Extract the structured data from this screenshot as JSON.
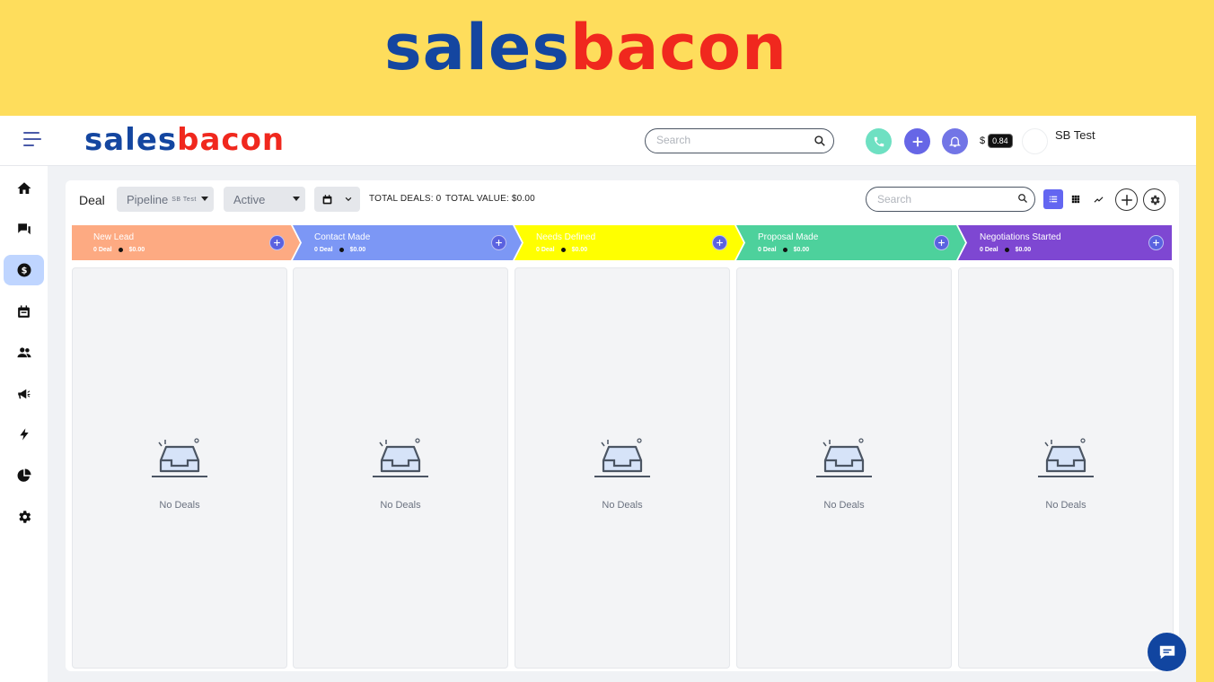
{
  "brand": {
    "part1": "sales",
    "part2": "bacon",
    "blue": "#1446a0",
    "red": "#f0281e"
  },
  "topbar": {
    "search_placeholder": "Search",
    "credit_currency": "$",
    "credit_value": "0.84",
    "user_name": "SB Test",
    "icons": [
      "menu-icon",
      "search-icon",
      "phone-icon",
      "plus-icon",
      "bell-icon"
    ]
  },
  "sidebar": {
    "items": [
      {
        "name": "home",
        "icon": "home-icon",
        "active": false
      },
      {
        "name": "conversations",
        "icon": "chat-icon",
        "active": false
      },
      {
        "name": "deals",
        "icon": "dollar-icon",
        "active": true
      },
      {
        "name": "calendar",
        "icon": "calendar-icon",
        "active": false
      },
      {
        "name": "contacts",
        "icon": "people-icon",
        "active": false
      },
      {
        "name": "campaigns",
        "icon": "megaphone-icon",
        "active": false
      },
      {
        "name": "automation",
        "icon": "bolt-icon",
        "active": false
      },
      {
        "name": "reports",
        "icon": "pie-chart-icon",
        "active": false
      },
      {
        "name": "settings",
        "icon": "gear-icon",
        "active": false
      }
    ]
  },
  "toolbar": {
    "title": "Deal",
    "pipeline_label": "Pipeline",
    "pipeline_sub": "SB Test",
    "status_value": "Active",
    "total_deals": "TOTAL DEALS: 0",
    "total_value": "TOTAL VALUE: $0.00",
    "search_placeholder": "Search"
  },
  "stages": [
    {
      "name": "New Lead",
      "deals": "0 Deal",
      "value": "$0.00",
      "color": "#fdaa82"
    },
    {
      "name": "Contact Made",
      "deals": "0 Deal",
      "value": "$0.00",
      "color": "#7c97f5"
    },
    {
      "name": "Needs Defined",
      "deals": "0 Deal",
      "value": "$0.00",
      "color": "#ffff00"
    },
    {
      "name": "Proposal Made",
      "deals": "0 Deal",
      "value": "$0.00",
      "color": "#4dd19c"
    },
    {
      "name": "Negotiations Started",
      "deals": "0 Deal",
      "value": "$0.00",
      "color": "#7e47d2"
    }
  ],
  "empty_text": "No Deals"
}
